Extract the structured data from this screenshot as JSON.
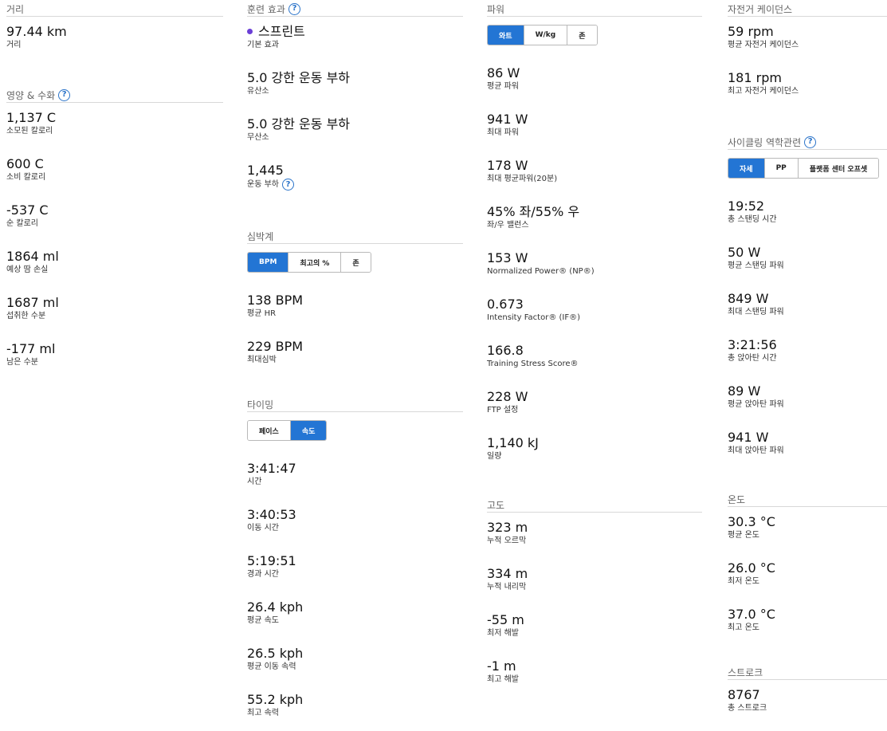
{
  "col1": {
    "distance": {
      "header": "거리",
      "value": "97.44 km",
      "label": "거리"
    },
    "nutrition": {
      "header": "영양 & 수화",
      "stats": [
        {
          "value": "1,137 C",
          "label": "소모된 칼로리"
        },
        {
          "value": "600 C",
          "label": "소비 칼로리"
        },
        {
          "value": "-537 C",
          "label": "순 칼로리"
        },
        {
          "value": "1864 ml",
          "label": "예상 땀 손실"
        },
        {
          "value": "1687 ml",
          "label": "섭취한 수분"
        },
        {
          "value": "-177 ml",
          "label": "남은 수분"
        }
      ]
    }
  },
  "col2": {
    "training": {
      "header": "훈련 효과",
      "stats": [
        {
          "value": "스프린트",
          "label": "기본 효과"
        },
        {
          "value": "5.0 강한 운동 부하",
          "label": "유산소"
        },
        {
          "value": "5.0 강한 운동 부하",
          "label": "무산소"
        },
        {
          "value": "1,445",
          "label": "운동 부하"
        }
      ]
    },
    "hr": {
      "header": "심박계",
      "tabs": [
        "BPM",
        "최고의 %",
        "존"
      ],
      "stats": [
        {
          "value": "138 BPM",
          "label": "평균 HR"
        },
        {
          "value": "229 BPM",
          "label": "최대심박"
        }
      ]
    },
    "timing": {
      "header": "타이밍",
      "tabs": [
        "페이스",
        "속도"
      ],
      "stats": [
        {
          "value": "3:41:47",
          "label": "시간"
        },
        {
          "value": "3:40:53",
          "label": "이동 시간"
        },
        {
          "value": "5:19:51",
          "label": "경과 시간"
        },
        {
          "value": "26.4 kph",
          "label": "평균 속도"
        },
        {
          "value": "26.5 kph",
          "label": "평균 이동 속력"
        },
        {
          "value": "55.2 kph",
          "label": "최고 속력"
        }
      ]
    }
  },
  "col3": {
    "power": {
      "header": "파워",
      "tabs": [
        "와트",
        "W/kg",
        "존"
      ],
      "stats": [
        {
          "value": "86 W",
          "label": "평균 파워"
        },
        {
          "value": "941 W",
          "label": "최대 파워"
        },
        {
          "value": "178 W",
          "label": "최대 평균파워(20분)"
        },
        {
          "value": "45% 좌/55% 우",
          "label": "좌/우 밸런스"
        },
        {
          "value": "153 W",
          "label": "Normalized Power® (NP®)"
        },
        {
          "value": "0.673",
          "label": "Intensity Factor® (IF®)"
        },
        {
          "value": "166.8",
          "label": "Training Stress Score®"
        },
        {
          "value": "228 W",
          "label": "FTP 설정"
        },
        {
          "value": "1,140 kJ",
          "label": "일량"
        }
      ]
    },
    "elevation": {
      "header": "고도",
      "stats": [
        {
          "value": "323 m",
          "label": "누적 오르막"
        },
        {
          "value": "334 m",
          "label": "누적 내리막"
        },
        {
          "value": "-55 m",
          "label": "최저 해발"
        },
        {
          "value": "-1 m",
          "label": "최고 해발"
        }
      ]
    }
  },
  "col4": {
    "cadence": {
      "header": "자전거 케이던스",
      "stats": [
        {
          "value": "59 rpm",
          "label": "평균 자전거 케이던스"
        },
        {
          "value": "181 rpm",
          "label": "최고 자전거 케이던스"
        }
      ]
    },
    "dynamics": {
      "header": "사이클링 역학관련",
      "tabs": [
        "자세",
        "PP",
        "플랫폼 센터 오프셋"
      ],
      "stats": [
        {
          "value": "19:52",
          "label": "총 스탠딩 시간"
        },
        {
          "value": "50 W",
          "label": "평균 스탠딩 파워"
        },
        {
          "value": "849 W",
          "label": "최대 스탠딩 파워"
        },
        {
          "value": "3:21:56",
          "label": "총 앉아탄 시간"
        },
        {
          "value": "89 W",
          "label": "평균 앉아탄 파워"
        },
        {
          "value": "941 W",
          "label": "최대 앉아탄 파워"
        }
      ]
    },
    "temperature": {
      "header": "온도",
      "stats": [
        {
          "value": "30.3 °C",
          "label": "평균 온도"
        },
        {
          "value": "26.0 °C",
          "label": "최저 온도"
        },
        {
          "value": "37.0 °C",
          "label": "최고 온도"
        }
      ]
    },
    "strokes": {
      "header": "스트로크",
      "stats": [
        {
          "value": "8767",
          "label": "총 스트로크"
        }
      ]
    }
  },
  "help_glyph": "?",
  "accent_color": "#2375d4",
  "bullet_color": "#6b3fd6"
}
